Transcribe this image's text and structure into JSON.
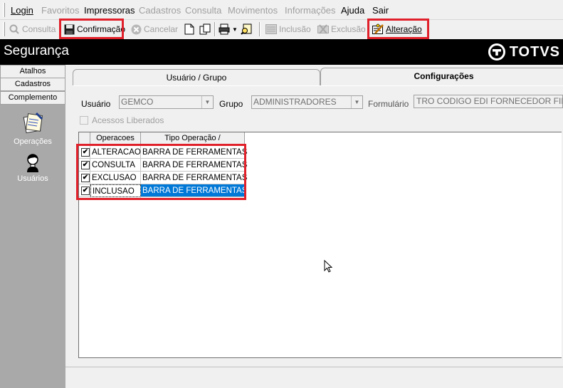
{
  "menu": {
    "items": [
      {
        "label": "Login",
        "enabled": true
      },
      {
        "label": "Favoritos",
        "enabled": false
      },
      {
        "label": "Impressoras",
        "enabled": true
      },
      {
        "label": "Cadastros",
        "enabled": false
      },
      {
        "label": "Consulta",
        "enabled": false
      },
      {
        "label": "Movimentos",
        "enabled": false
      },
      {
        "label": "Informações",
        "enabled": false
      },
      {
        "label": "Ajuda",
        "enabled": true
      },
      {
        "label": "Sair",
        "enabled": true
      }
    ]
  },
  "toolbar": {
    "consulta": "Consulta",
    "confirmacao": "Confirmação",
    "cancelar": "Cancelar",
    "inclusao": "Inclusão",
    "exclusao": "Exclusão",
    "alteracao": "Alteração"
  },
  "window": {
    "title": "Segurança",
    "logo": "TOTVS"
  },
  "sidebar": {
    "tabs": [
      "Atalhos",
      "Cadastros",
      "Complemento"
    ],
    "items": [
      {
        "label": "Operações",
        "icon": "operations-icon"
      },
      {
        "label": "Usuários",
        "icon": "users-icon"
      }
    ]
  },
  "tabs": {
    "usuario_grupo": "Usuário  / Grupo",
    "configuracoes": "Configurações"
  },
  "form": {
    "usuario_label": "Usuário",
    "usuario_value": "GEMCO",
    "grupo_label": "Grupo",
    "grupo_value": "ADMINISTRADORES",
    "formulario_label": "Formulário",
    "formulario_value": "TRO CODIGO EDI FORNECEDOR FILIAL",
    "acessos_label": "Acessos Liberados"
  },
  "grid": {
    "columns": [
      "Operacoes",
      "Tipo Operação  /"
    ],
    "rows": [
      {
        "operacao": "ALTERACAO",
        "tipo": "BARRA DE FERRAMENTAS",
        "checked": true
      },
      {
        "operacao": "CONSULTA",
        "tipo": "BARRA DE FERRAMENTAS",
        "checked": true
      },
      {
        "operacao": "EXCLUSAO",
        "tipo": "BARRA DE FERRAMENTAS",
        "checked": true
      },
      {
        "operacao": "INCLUSAO",
        "tipo": "BARRA DE FERRAMENTAS",
        "checked": true
      }
    ],
    "check_glyph": "✔"
  },
  "colors": {
    "highlight_box": "#e0202a",
    "selection": "#0078d7",
    "title_bar": "#000000",
    "sidebar": "#a9a9a9"
  }
}
